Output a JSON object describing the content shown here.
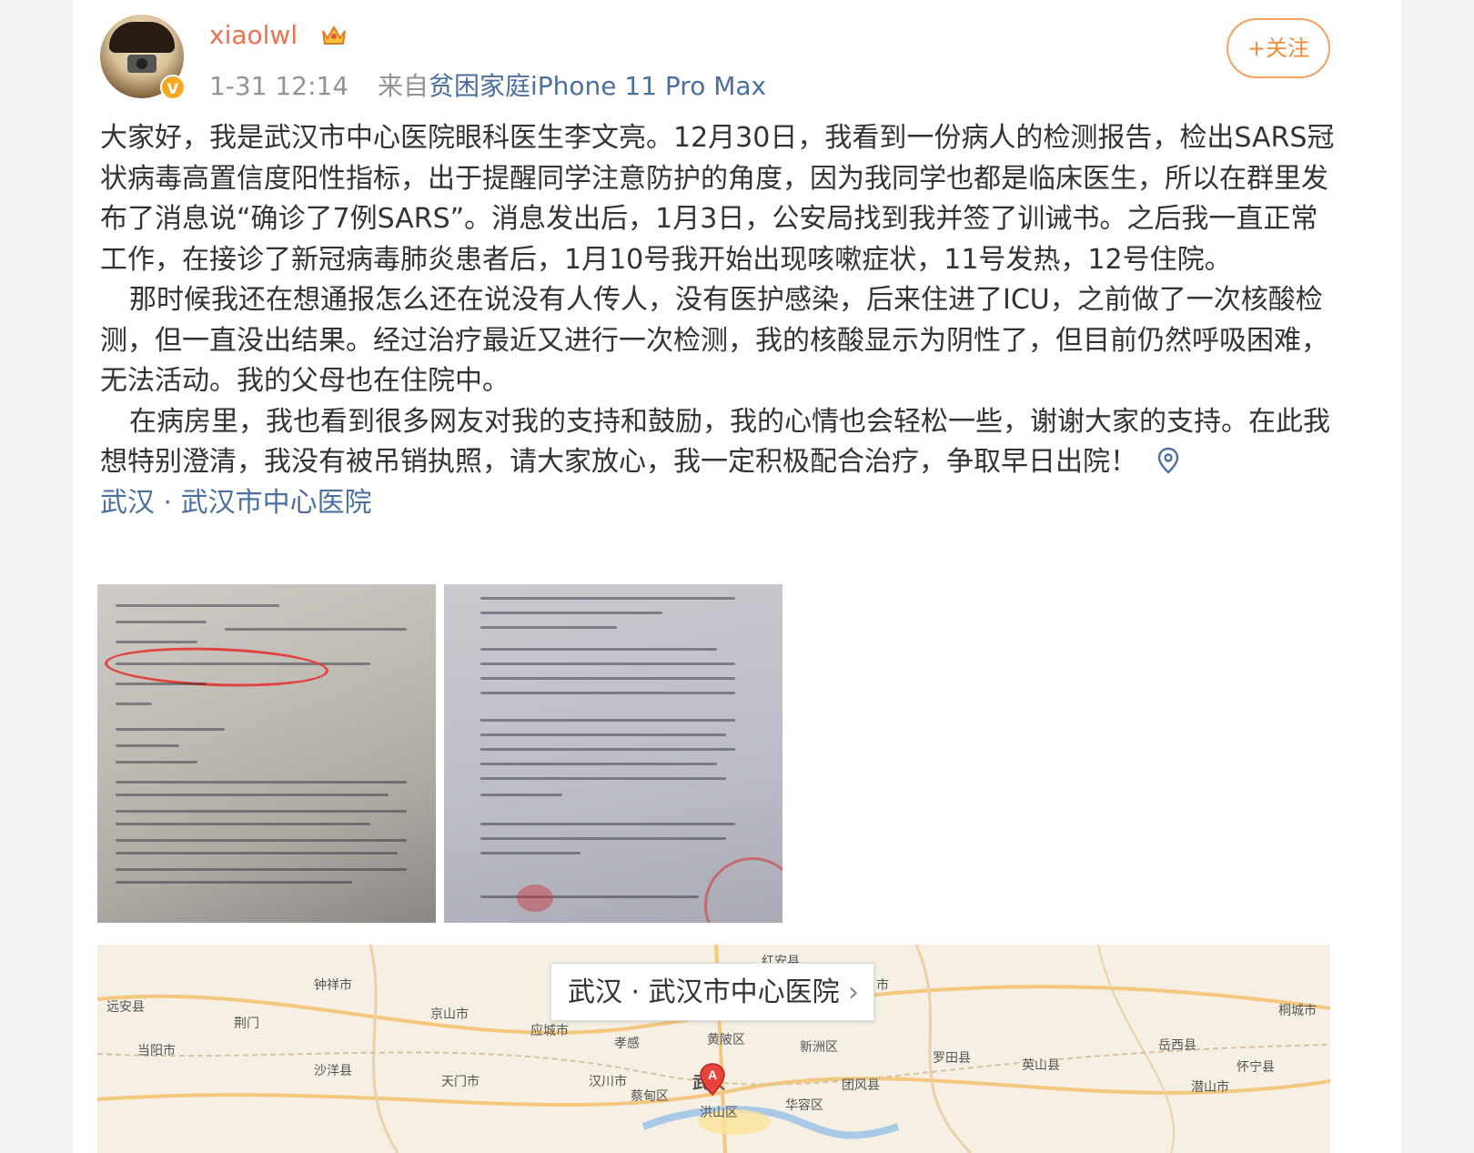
{
  "user": {
    "name": "xiaolwl",
    "verified_badge": "V",
    "time": "1-31 12:14",
    "from_label": "来自",
    "source": "贫困家庭iPhone 11 Pro Max"
  },
  "follow_button": "+关注",
  "post": {
    "paragraphs": [
      "大家好，我是武汉市中心医院眼科医生李文亮。12月30日，我看到一份病人的检测报告，检出SARS冠状病毒高置信度阳性指标，出于提醒同学注意防护的角度，因为我同学也都是临床医生，所以在群里发布了消息说“确诊了7例SARS”。消息发出后，1月3日，公安局找到我并签了训诫书。之后我一直正常工作，在接诊了新冠病毒肺炎患者后，1月10号我开始出现咳嗽症状，11号发热，12号住院。",
      "那时候我还在想通报怎么还在说没有人传人，没有医护感染，后来住进了ICU，之前做了一次核酸检测，但一直没出结果。经过治疗最近又进行一次检测，我的核酸显示为阴性了，但目前仍然呼吸困难，无法活动。我的父母也在住院中。",
      "在病房里，我也看到很多网友对我的支持和鼓励，我的心情也会轻松一些，谢谢大家的支持。在此我想特别澄清，我没有被吊销执照，请大家放心，我一定积极配合治疗，争取早日出院！"
    ],
    "location": "武汉 · 武汉市中心医院"
  },
  "icons": {
    "verified": "verified-v-icon",
    "crown": "crown-icon",
    "location": "location-pin-icon",
    "chevron": "chevron-right-icon",
    "marker": "map-marker-icon"
  },
  "colors": {
    "username": "#eb7350",
    "link": "#4b6f9e",
    "follow": "#f08b3a",
    "badge": "#f5a623"
  },
  "map": {
    "label": "武汉 · 武汉市中心医院",
    "marker_letter": "A",
    "cities": [
      "远安县",
      "钟祥市",
      "荆门",
      "京山市",
      "应城市",
      "孝感",
      "黄陂区",
      "红安县",
      "新洲区",
      "罗田县",
      "英山县",
      "岳西县",
      "桐城市",
      "怀宁县",
      "潜山市",
      "当阳市",
      "沙洋县",
      "天门市",
      "汉川市",
      "蔡甸区",
      "武汉",
      "洪山区",
      "华容区",
      "团风县",
      "市"
    ]
  }
}
